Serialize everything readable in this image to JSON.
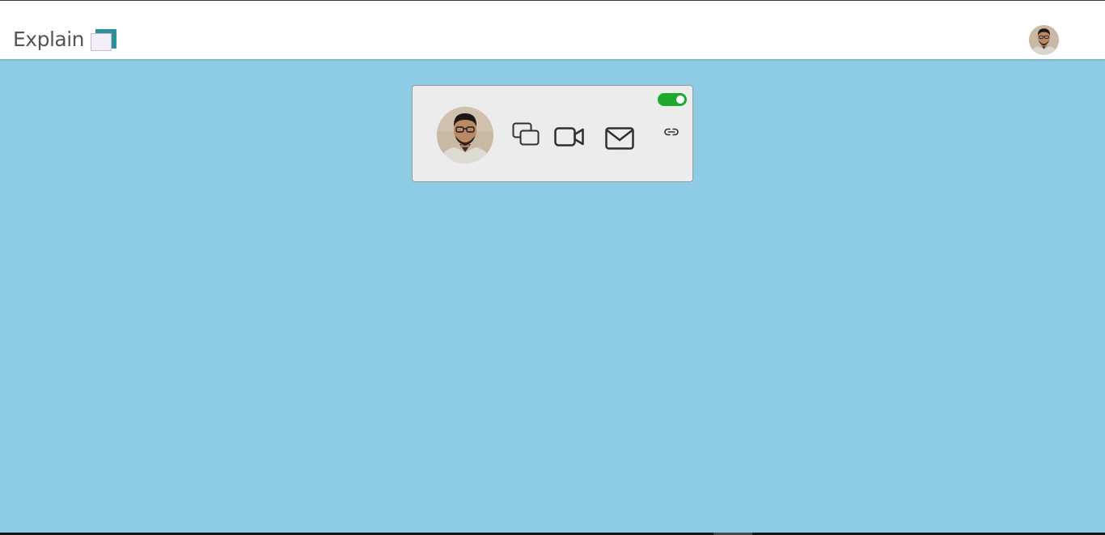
{
  "app": {
    "brand_name": "Explain",
    "brand_logo_icon": "stacked-squares-logo",
    "colors": {
      "background": "#8ecce5",
      "header": "#ffffff",
      "card": "#ececec",
      "toggle_on": "#1faa2e",
      "logo_accent": "#2d8f97"
    }
  },
  "header": {
    "avatar_icon": "user-avatar"
  },
  "profile_card": {
    "avatar_icon": "user-avatar",
    "availability_toggle": {
      "state": "on",
      "icon": "toggle-switch"
    },
    "actions": [
      {
        "name": "chat",
        "icon": "chat-bubbles-icon"
      },
      {
        "name": "video",
        "icon": "video-camera-icon"
      },
      {
        "name": "email",
        "icon": "envelope-icon"
      },
      {
        "name": "link",
        "icon": "link-icon"
      }
    ]
  }
}
